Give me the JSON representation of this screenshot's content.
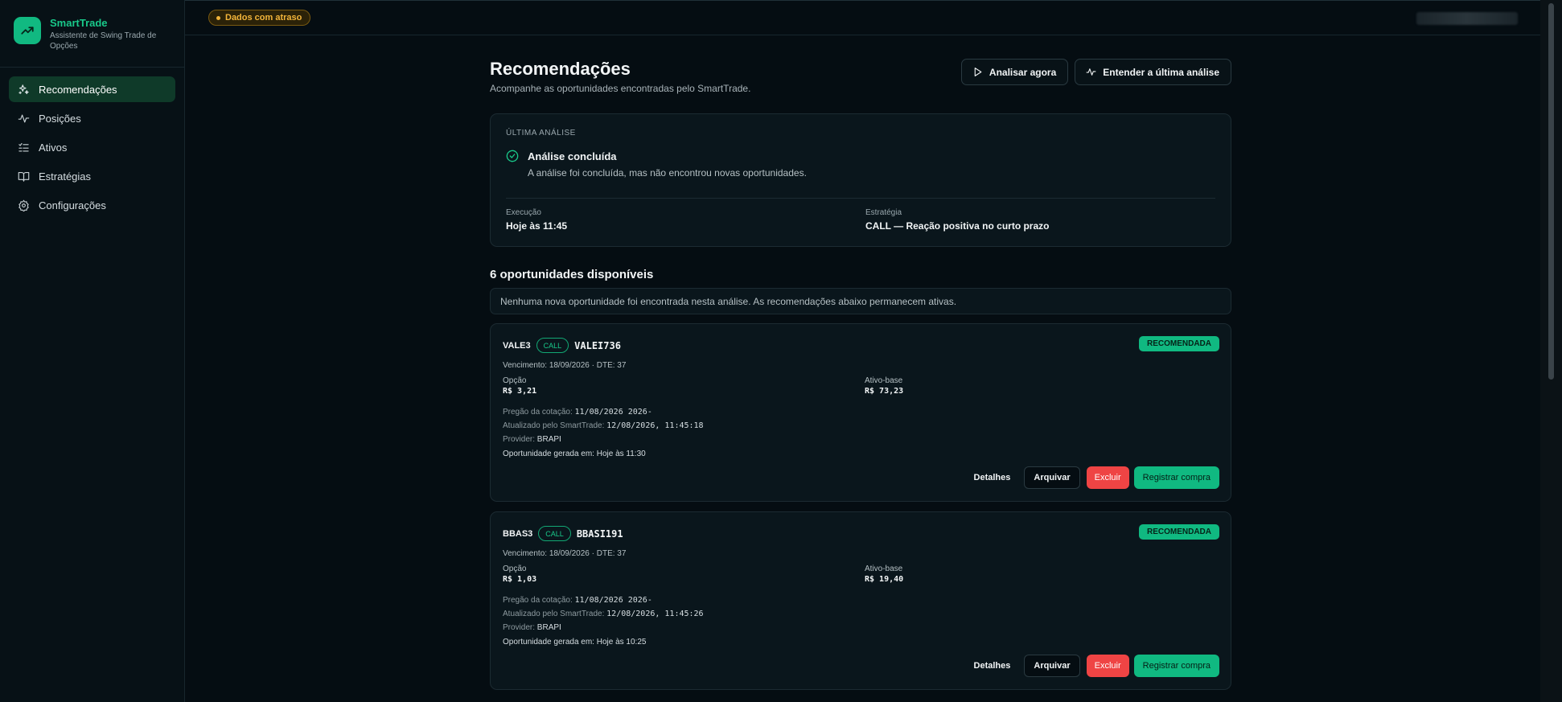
{
  "brand": {
    "name": "SmartTrade",
    "subtitle": "Assistente de Swing Trade de Opções"
  },
  "sidebar": {
    "items": [
      {
        "label": "Recomendações",
        "icon": "sparkles-icon",
        "active": true
      },
      {
        "label": "Posições",
        "icon": "activity-icon",
        "active": false
      },
      {
        "label": "Ativos",
        "icon": "list-check-icon",
        "active": false
      },
      {
        "label": "Estratégias",
        "icon": "book-open-icon",
        "active": false
      },
      {
        "label": "Configurações",
        "icon": "gear-icon",
        "active": false
      }
    ]
  },
  "topbar": {
    "delay_badge": "Dados com atraso"
  },
  "header": {
    "title": "Recomendações",
    "subtitle": "Acompanhe as oportunidades encontradas pelo SmartTrade.",
    "analyze_now": "Analisar agora",
    "explain_last": "Entender a última análise"
  },
  "analysis": {
    "section_label": "ÚLTIMA ANÁLISE",
    "status_title": "Análise concluída",
    "status_desc": "A análise foi concluída, mas não encontrou novas oportunidades.",
    "execution_label": "Execução",
    "execution_value": "Hoje às 11:45",
    "strategy_label": "Estratégia",
    "strategy_value": "CALL — Reação positiva no curto prazo"
  },
  "opportunities": {
    "title": "6 oportunidades disponíveis",
    "info": "Nenhuma nova oportunidade foi encontrada nesta análise. As recomendações abaixo permanecem ativas.",
    "items": [
      {
        "ticker": "VALE3",
        "type": "CALL",
        "code": "VALEI736",
        "badge": "RECOMENDADA",
        "expiry": "Vencimento: 18/09/2026 · DTE: 37",
        "option_label": "Opção",
        "option_value": "R$ 3,21",
        "base_label": "Ativo-base",
        "base_value": "R$ 73,23",
        "quote_label": "Pregão da cotação:",
        "quote_value": "11/08/2026 2026-",
        "updated_label": "Atualizado pelo SmartTrade:",
        "updated_value": "12/08/2026, 11:45:18",
        "provider_label": "Provider:",
        "provider_value": "BRAPI",
        "generated": "Oportunidade gerada em: Hoje às 11:30",
        "btn_details": "Detalhes",
        "btn_archive": "Arquivar",
        "btn_delete": "Excluir",
        "btn_buy": "Registrar compra"
      },
      {
        "ticker": "BBAS3",
        "type": "CALL",
        "code": "BBASI191",
        "badge": "RECOMENDADA",
        "expiry": "Vencimento: 18/09/2026 · DTE: 37",
        "option_label": "Opção",
        "option_value": "R$ 1,03",
        "base_label": "Ativo-base",
        "base_value": "R$ 19,40",
        "quote_label": "Pregão da cotação:",
        "quote_value": "11/08/2026 2026-",
        "updated_label": "Atualizado pelo SmartTrade:",
        "updated_value": "12/08/2026, 11:45:26",
        "provider_label": "Provider:",
        "provider_value": "BRAPI",
        "generated": "Oportunidade gerada em: Hoje às 10:25",
        "btn_details": "Detalhes",
        "btn_archive": "Arquivar",
        "btn_delete": "Excluir",
        "btn_buy": "Registrar compra"
      }
    ]
  },
  "colors": {
    "accent": "#10b981",
    "danger": "#ef4444",
    "warning": "#f2b43a",
    "background": "#050d12"
  }
}
